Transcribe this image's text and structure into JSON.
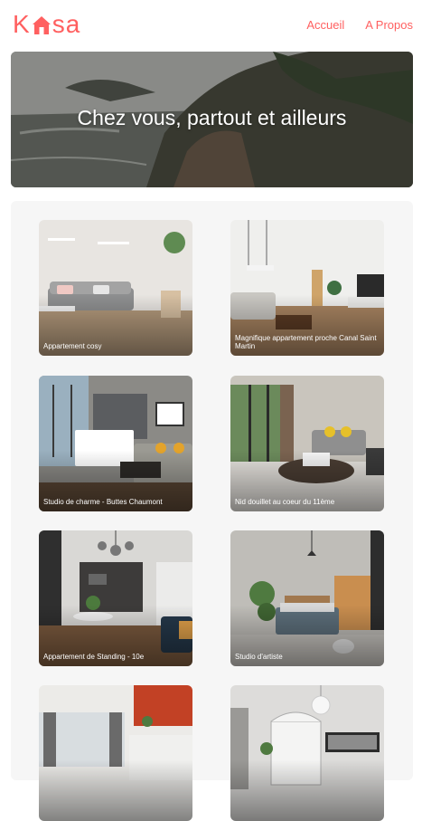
{
  "brand": {
    "logo_left": "K",
    "logo_right": "sa",
    "color": "#FF6060"
  },
  "nav": {
    "home": "Accueil",
    "about": "A Propos"
  },
  "hero": {
    "title": "Chez vous, partout et ailleurs"
  },
  "listings": [
    {
      "title": "Appartement cosy"
    },
    {
      "title": "Magnifique appartement proche Canal Saint Martin"
    },
    {
      "title": "Studio de charme - Buttes Chaumont"
    },
    {
      "title": "Nid douillet au coeur du 11ème"
    },
    {
      "title": "Appartement de Standing - 10e"
    },
    {
      "title": "Studio d'artiste"
    },
    {
      "title": ""
    },
    {
      "title": ""
    }
  ]
}
